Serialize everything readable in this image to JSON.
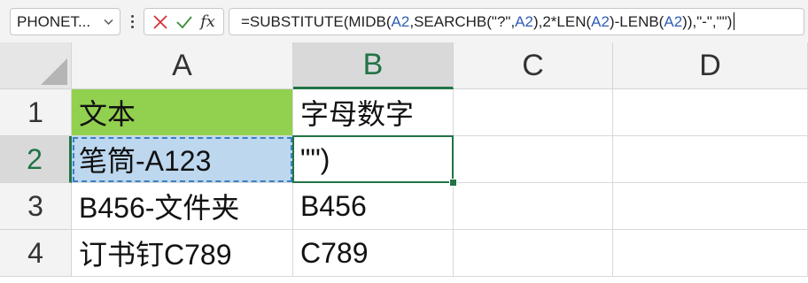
{
  "formula_bar": {
    "name_box": "PHONET...",
    "formula_parts": [
      {
        "text": "=SUBSTITUTE(MIDB(",
        "ref": false
      },
      {
        "text": "A2",
        "ref": true
      },
      {
        "text": ",SEARCHB(\"?\",",
        "ref": false
      },
      {
        "text": "A2",
        "ref": true
      },
      {
        "text": "),2*LEN(",
        "ref": false
      },
      {
        "text": "A2",
        "ref": true
      },
      {
        "text": ")-LENB(",
        "ref": false
      },
      {
        "text": "A2",
        "ref": true
      },
      {
        "text": ")),\"-\",\"\")",
        "ref": false
      }
    ],
    "fx_label": "fx",
    "cancel_icon": "close-icon",
    "enter_icon": "check-icon"
  },
  "colors": {
    "accent": "#217346",
    "a1_fill": "#92d050",
    "a2_fill": "#bcd7ee",
    "ref_color": "#2f5eb3"
  },
  "sheet": {
    "columns": [
      "A",
      "B",
      "C",
      "D"
    ],
    "selected_column": "B",
    "rows": [
      {
        "label": "1",
        "cells": [
          "文本",
          "字母数字",
          "",
          ""
        ]
      },
      {
        "label": "2",
        "cells": [
          "笔筒-A123",
          "\"\")",
          "",
          ""
        ]
      },
      {
        "label": "3",
        "cells": [
          "B456-文件夹",
          "B456",
          "",
          ""
        ]
      },
      {
        "label": "4",
        "cells": [
          "订书钉C789",
          "C789",
          "",
          ""
        ]
      }
    ],
    "selected_row": "2"
  }
}
